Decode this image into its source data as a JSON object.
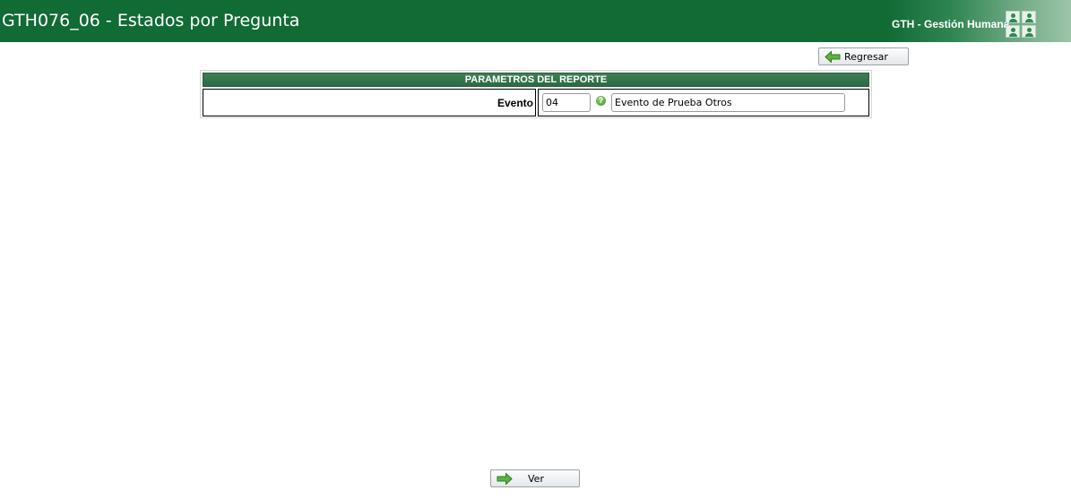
{
  "header": {
    "title": "GTH076_06 - Estados por Pregunta",
    "brand": "GTH - Gestión Humana",
    "brand_icon": "users-grid-icon",
    "color": "#116b35"
  },
  "toolbar": {
    "back_label": "Regresar",
    "back_icon": "arrow-left-icon"
  },
  "parameters": {
    "header": "PARAMETROS DEL REPORTE",
    "fields": [
      {
        "label": "Evento",
        "code_value": "04",
        "help_icon": "help-icon",
        "description_value": "Evento de Prueba Otros"
      }
    ]
  },
  "footer": {
    "view_label": "Ver",
    "view_icon": "arrow-right-icon"
  }
}
